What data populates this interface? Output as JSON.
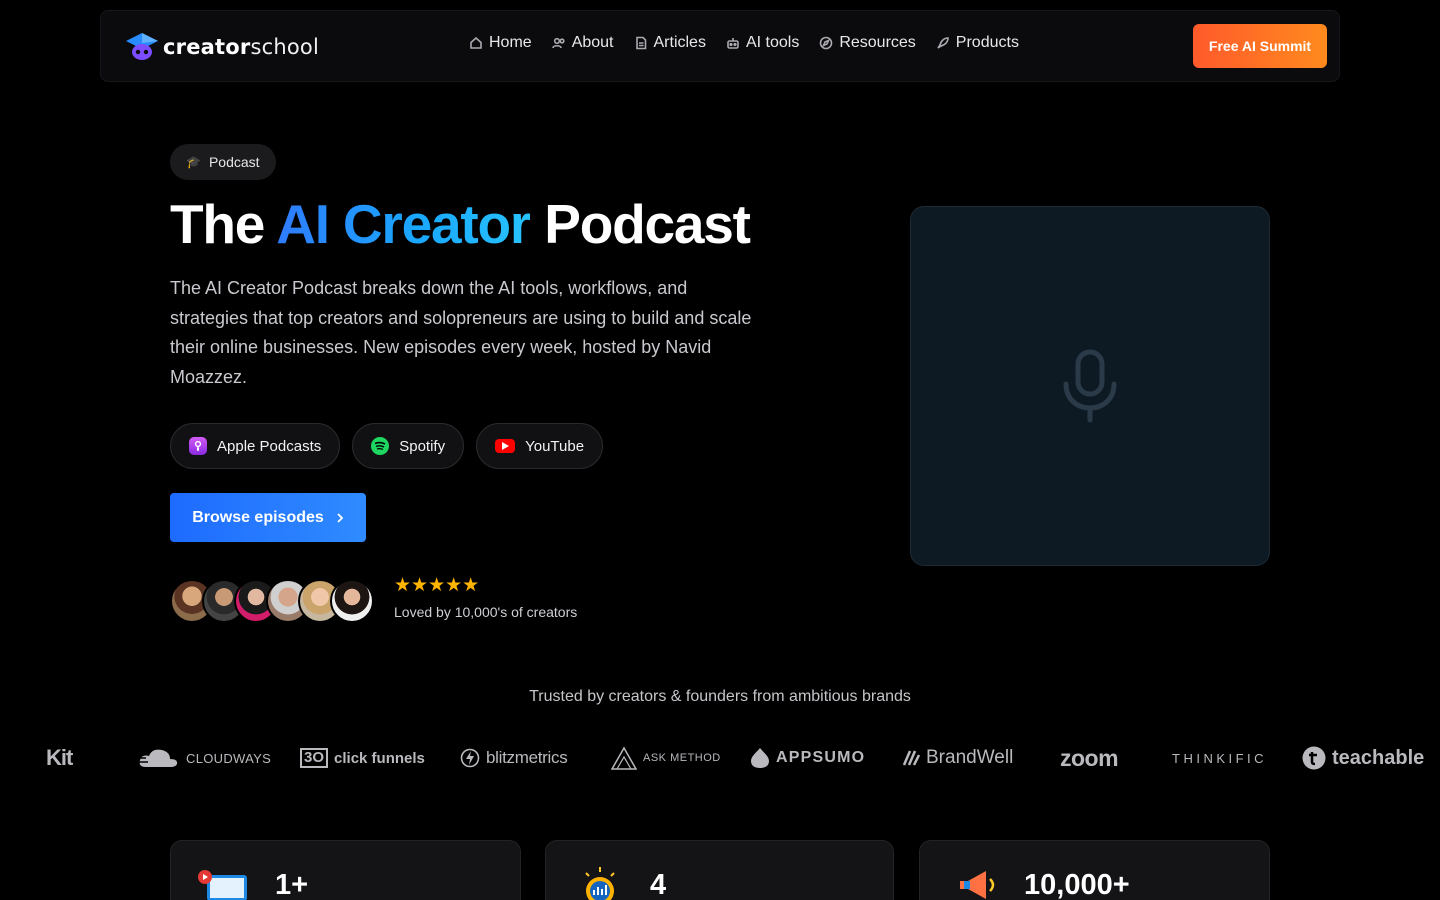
{
  "nav": {
    "logo": {
      "bold": "creator",
      "light": "school"
    },
    "items": [
      {
        "label": "Home",
        "icon": "home-icon"
      },
      {
        "label": "About",
        "icon": "users-icon"
      },
      {
        "label": "Articles",
        "icon": "document-icon"
      },
      {
        "label": "AI tools",
        "icon": "robot-icon"
      },
      {
        "label": "Resources",
        "icon": "compass-icon"
      },
      {
        "label": "Products",
        "icon": "rocket-icon"
      }
    ],
    "cta": "Free AI Summit"
  },
  "hero": {
    "pill": "Podcast",
    "title_before": "The ",
    "title_highlight": "AI Creator",
    "title_after": " Podcast",
    "description": "The AI Creator Podcast breaks down the AI tools, workflows, and strategies that top creators and solopreneurs are using to build and scale their online businesses. New episodes every week, hosted by Navid Moazzez.",
    "platforms": [
      "Apple Podcasts",
      "Spotify",
      "YouTube"
    ],
    "browse": "Browse episodes",
    "stars": "★★★★★",
    "loved": "Loved by 10,000's of creators"
  },
  "trusted": {
    "heading": "Trusted by creators & founders from ambitious brands",
    "brands": [
      "Kit",
      "CLOUDWAYS",
      "click funnels",
      "blitzmetrics",
      "ASK METHOD",
      "APPSUMO",
      "BrandWell",
      "zoom",
      "THINKIFIC",
      "teachable"
    ]
  },
  "stats": [
    "1+",
    "4",
    "10,000+"
  ],
  "colors": {
    "accent_blue": "#1e6bff",
    "cta_orange": "#ff6a25",
    "star": "#ffb400"
  }
}
